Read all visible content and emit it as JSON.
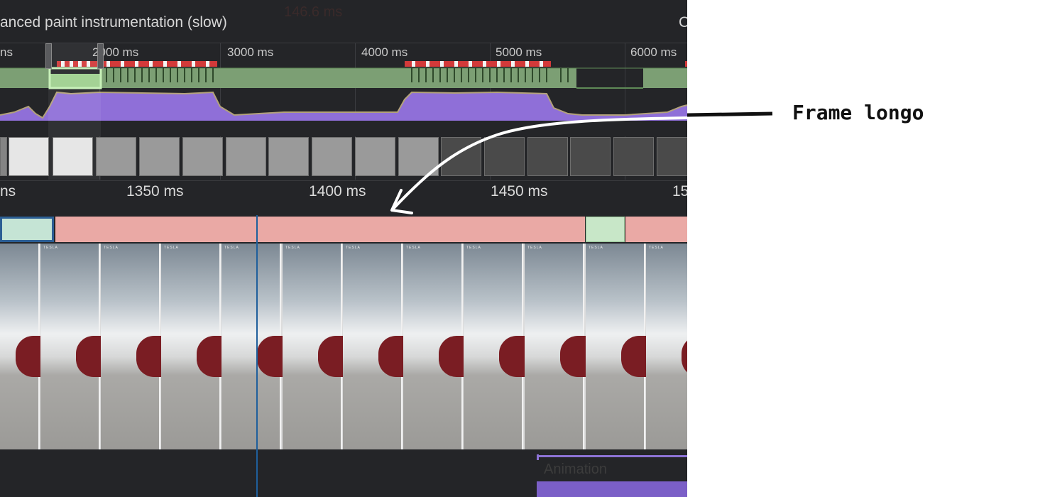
{
  "topbar": {
    "checkbox_label": "anced paint instrumentation (slow)",
    "cut_label": "C"
  },
  "overview_ticks": [
    "ns",
    "2000 ms",
    "3000 ms",
    "4000 ms",
    "5000 ms",
    "6000 ms"
  ],
  "ruler_ticks": [
    "ns",
    "1350 ms",
    "1400 ms",
    "1450 ms",
    "15"
  ],
  "frames": {
    "selected_duration": "146.6 ms"
  },
  "track": {
    "animation_label": "Animation"
  },
  "shot_logo": "TESLA",
  "callout": {
    "text": "Frame longo"
  },
  "colors": {
    "long_frame": "#eaa9a5",
    "ok_frame": "#c8e7c8",
    "cpu_purple": "#8f6fd8",
    "fps_green": "#7c9f74",
    "accent_blue": "#1f5f9c"
  }
}
